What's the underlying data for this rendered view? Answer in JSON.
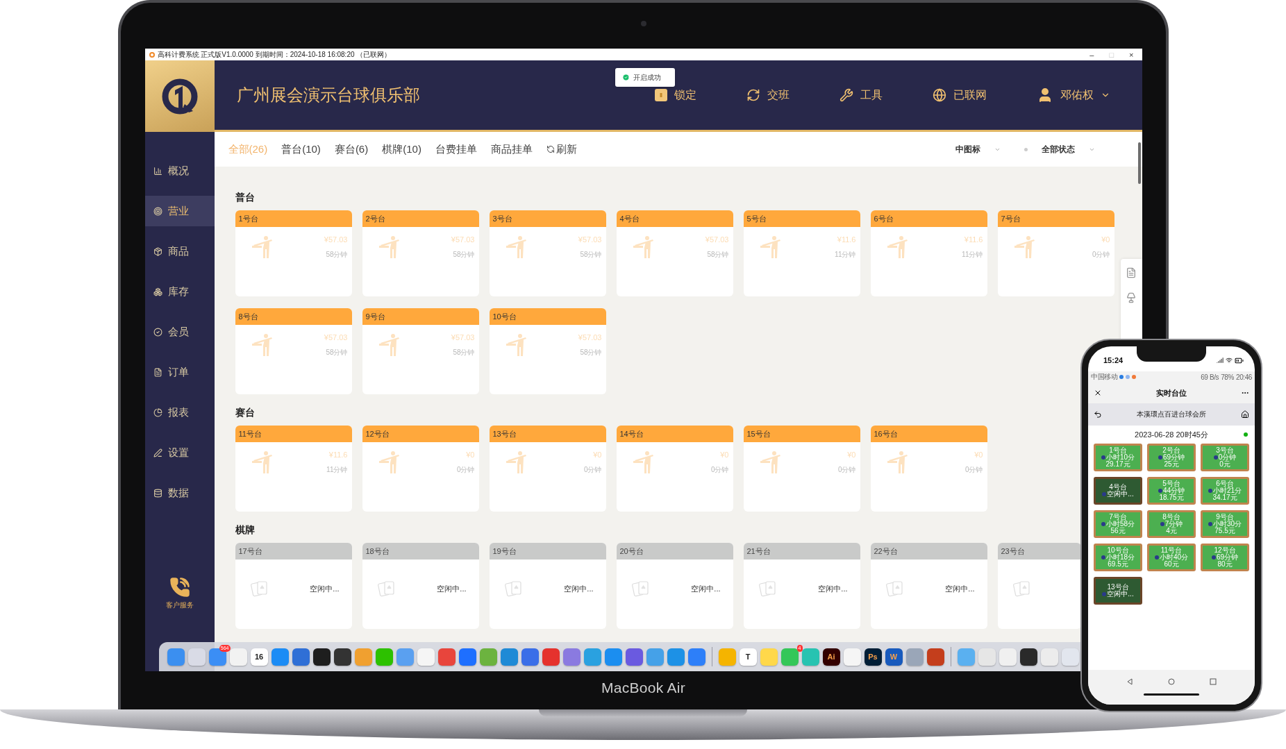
{
  "window": {
    "title": "高科计费系统 正式版V1.0.0000 到期时间：2024-10-18 16:08:20 （已联网）",
    "controls": [
      {
        "glyph": "–",
        "disabled": false
      },
      {
        "glyph": "□",
        "disabled": true
      },
      {
        "glyph": "×",
        "disabled": false
      }
    ]
  },
  "header": {
    "club_name": "广州展会演示台球俱乐部",
    "toast": "开启成功",
    "nav": [
      {
        "kind": "lock",
        "label": "锁定"
      },
      {
        "kind": "shift",
        "label": "交班"
      },
      {
        "kind": "tools",
        "label": "工具"
      },
      {
        "kind": "network",
        "label": "已联网"
      },
      {
        "kind": "user",
        "label": "邓佑权"
      }
    ]
  },
  "sidebar": {
    "items": [
      {
        "kind": "overview",
        "label": "概况",
        "selected": false
      },
      {
        "kind": "business",
        "label": "营业",
        "selected": true
      },
      {
        "kind": "goods",
        "label": "商品",
        "selected": false
      },
      {
        "kind": "stock",
        "label": "库存",
        "selected": false
      },
      {
        "kind": "member",
        "label": "会员",
        "selected": false
      },
      {
        "kind": "order",
        "label": "订单",
        "selected": false
      },
      {
        "kind": "report",
        "label": "报表",
        "selected": false
      },
      {
        "kind": "settings",
        "label": "设置",
        "selected": false
      },
      {
        "kind": "data",
        "label": "数据",
        "selected": false
      }
    ],
    "service": "客户服务"
  },
  "tabs": [
    {
      "label": "全部(26)",
      "selected": true
    },
    {
      "label": "普台(10)",
      "selected": false
    },
    {
      "label": "赛台(6)",
      "selected": false
    },
    {
      "label": "棋牌(10)",
      "selected": false
    },
    {
      "label": "台费挂单",
      "selected": false
    },
    {
      "label": "商品挂单",
      "selected": false
    },
    {
      "label": "刷新",
      "selected": false,
      "kind": "refresh"
    }
  ],
  "filters": [
    {
      "label": "中图标",
      "kind": "plain"
    },
    {
      "label": "全部状态",
      "kind": "dot"
    }
  ],
  "sections": [
    {
      "title": "普台",
      "tables": [
        {
          "kind": "billiard",
          "name": "1号台",
          "price": "¥57.03",
          "duration": "58分钟"
        },
        {
          "kind": "billiard",
          "name": "2号台",
          "price": "¥57.03",
          "duration": "58分钟"
        },
        {
          "kind": "billiard",
          "name": "3号台",
          "price": "¥57.03",
          "duration": "58分钟"
        },
        {
          "kind": "billiard",
          "name": "4号台",
          "price": "¥57.03",
          "duration": "58分钟"
        },
        {
          "kind": "billiard",
          "name": "5号台",
          "price": "¥11.6",
          "duration": "11分钟"
        },
        {
          "kind": "billiard",
          "name": "6号台",
          "price": "¥11.6",
          "duration": "11分钟"
        },
        {
          "kind": "billiard",
          "name": "7号台",
          "price": "¥0",
          "duration": "0分钟"
        },
        {
          "kind": "billiard",
          "name": "8号台",
          "price": "¥57.03",
          "duration": "58分钟"
        },
        {
          "kind": "billiard",
          "name": "9号台",
          "price": "¥57.03",
          "duration": "58分钟"
        },
        {
          "kind": "billiard",
          "name": "10号台",
          "price": "¥57.03",
          "duration": "58分钟"
        }
      ]
    },
    {
      "title": "赛台",
      "tables": [
        {
          "kind": "billiard",
          "name": "11号台",
          "price": "¥11.6",
          "duration": "11分钟"
        },
        {
          "kind": "billiard",
          "name": "12号台",
          "price": "¥0",
          "duration": "0分钟"
        },
        {
          "kind": "billiard",
          "name": "13号台",
          "price": "¥0",
          "duration": "0分钟"
        },
        {
          "kind": "billiard",
          "name": "14号台",
          "price": "¥0",
          "duration": "0分钟"
        },
        {
          "kind": "billiard",
          "name": "15号台",
          "price": "¥0",
          "duration": "0分钟"
        },
        {
          "kind": "billiard",
          "name": "16号台",
          "price": "¥0",
          "duration": "0分钟"
        }
      ]
    },
    {
      "title": "棋牌",
      "tables": [
        {
          "kind": "chess",
          "name": "17号台",
          "status": "空闲中..."
        },
        {
          "kind": "chess",
          "name": "18号台",
          "status": "空闲中..."
        },
        {
          "kind": "chess",
          "name": "19号台",
          "status": "空闲中..."
        },
        {
          "kind": "chess",
          "name": "20号台",
          "status": "空闲中..."
        },
        {
          "kind": "chess",
          "name": "21号台",
          "status": "空闲中..."
        },
        {
          "kind": "chess",
          "name": "22号台",
          "status": "空闲中..."
        },
        {
          "kind": "chess",
          "name": "23号台"
        }
      ]
    }
  ],
  "dock": [
    {
      "kind": "app",
      "color": "#3b8ff0"
    },
    {
      "kind": "app",
      "color": "#d9dbe6"
    },
    {
      "kind": "app",
      "color": "#3b8ef5",
      "badge": "564"
    },
    {
      "kind": "app",
      "color": "#f2f2f2"
    },
    {
      "kind": "app",
      "color": "#ffffff",
      "label": "16"
    },
    {
      "kind": "app",
      "color": "#1c8cf5"
    },
    {
      "kind": "app",
      "color": "#2f6fd6"
    },
    {
      "kind": "app",
      "color": "#1e1e1e"
    },
    {
      "kind": "app",
      "color": "#333333"
    },
    {
      "kind": "app",
      "color": "#f0a030"
    },
    {
      "kind": "app",
      "color": "#2dc100"
    },
    {
      "kind": "app",
      "color": "#5aa0f0"
    },
    {
      "kind": "app",
      "color": "#f5f5f5"
    },
    {
      "kind": "app",
      "color": "#e8453c"
    },
    {
      "kind": "app",
      "color": "#1e6fff"
    },
    {
      "kind": "app",
      "color": "#6cb33f"
    },
    {
      "kind": "app",
      "color": "#1e8ad6"
    },
    {
      "kind": "app",
      "color": "#3a6ee8"
    },
    {
      "kind": "app",
      "color": "#e5322d"
    },
    {
      "kind": "app",
      "color": "#8a7ae0"
    },
    {
      "kind": "app",
      "color": "#2aa1e0"
    },
    {
      "kind": "app",
      "color": "#1b8ef0"
    },
    {
      "kind": "app",
      "color": "#6a5ae0"
    },
    {
      "kind": "app",
      "color": "#45a1e8"
    },
    {
      "kind": "app",
      "color": "#1d91e6"
    },
    {
      "kind": "app",
      "color": "#2d7ff9"
    },
    {
      "kind": "separator"
    },
    {
      "kind": "app",
      "color": "#f5b400"
    },
    {
      "kind": "app",
      "color": "#ffffff",
      "label": "T"
    },
    {
      "kind": "app",
      "color": "#ffd84a"
    },
    {
      "kind": "app",
      "color": "#34c759",
      "badge": "4"
    },
    {
      "kind": "app",
      "color": "#27c3b1"
    },
    {
      "kind": "app",
      "color": "#330000",
      "label": "Ai"
    },
    {
      "kind": "app",
      "color": "#f5f5f5"
    },
    {
      "kind": "app",
      "color": "#001e36",
      "label": "Ps"
    },
    {
      "kind": "app",
      "color": "#185abd",
      "label": "W"
    },
    {
      "kind": "app",
      "color": "#9aa6b8"
    },
    {
      "kind": "app",
      "color": "#c43e1c"
    },
    {
      "kind": "separator"
    },
    {
      "kind": "app",
      "color": "#5ab0f0"
    },
    {
      "kind": "app",
      "color": "#e6e6e6"
    },
    {
      "kind": "app",
      "color": "#f0f0f0"
    },
    {
      "kind": "app",
      "color": "#2a2a2a"
    },
    {
      "kind": "app",
      "color": "#ececec"
    },
    {
      "kind": "app",
      "color": "#e2e6ee"
    }
  ],
  "laptop_label": "MacBook Air",
  "phone": {
    "time": "15:24",
    "carrier": "中国移动",
    "speed": "69 B/s",
    "battery": "78%",
    "clock": "20:46",
    "title": "实时台位",
    "venue": "本溪環点百进台球会所",
    "date": "2023-06-28 20时45分",
    "online": true,
    "tables": [
      {
        "name": "1号台",
        "duration": "小时10分",
        "amount": "29.17元",
        "idle": false
      },
      {
        "name": "2号台",
        "duration": "69分钟",
        "amount": "25元",
        "idle": false
      },
      {
        "name": "3号台",
        "duration": "0分钟",
        "amount": "0元",
        "idle": false
      },
      {
        "name": "4号台",
        "duration": "空闲中...",
        "idle": true
      },
      {
        "name": "5号台",
        "duration": "44分钟",
        "amount": "18.75元",
        "idle": false
      },
      {
        "name": "6号台",
        "duration": "小时21分",
        "amount": "34.17元",
        "idle": false
      },
      {
        "name": "7号台",
        "duration": "小时58分",
        "amount": "56元",
        "idle": false
      },
      {
        "name": "8号台",
        "duration": "7分钟",
        "amount": "4元",
        "idle": false
      },
      {
        "name": "9号台",
        "duration": "小时30分",
        "amount": "75.5元",
        "idle": false
      },
      {
        "name": "10号台",
        "duration": "小时18分",
        "amount": "69.5元",
        "idle": false
      },
      {
        "name": "11号台",
        "duration": "小时40分",
        "amount": "60元",
        "idle": false
      },
      {
        "name": "12号台",
        "duration": "69分钟",
        "amount": "80元",
        "idle": false
      },
      {
        "name": "13号台",
        "duration": "空闲中...",
        "idle": true
      }
    ]
  }
}
